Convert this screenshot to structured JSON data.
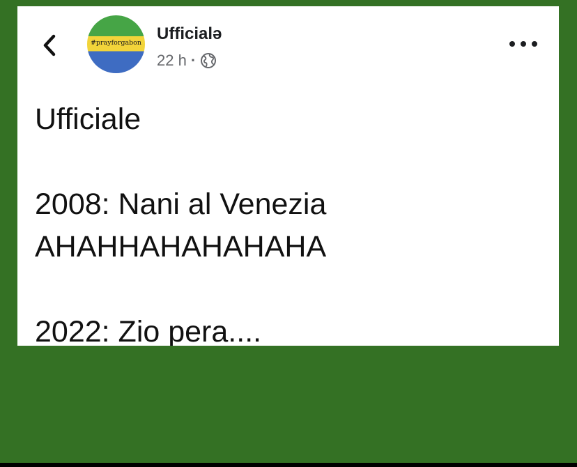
{
  "post": {
    "author": "Ufficialə",
    "time": "22 h",
    "separator": "·",
    "avatar_text": "#prayforgabon",
    "text": "Ufficiale\n\n2008: Nani al Venezia\nAHAHHAHAHAHAHA\n\n2022: Zio pera...."
  },
  "icons": {
    "back": "chevron-left-icon",
    "audience": "globe-icon",
    "more": "more-horizontal-icon"
  },
  "colors": {
    "background": "#347124",
    "card": "#ffffff",
    "text": "#111111",
    "meta": "#65676b",
    "flag_green": "#46a546",
    "flag_yellow": "#f2d43a",
    "flag_blue": "#3e6cc2"
  }
}
